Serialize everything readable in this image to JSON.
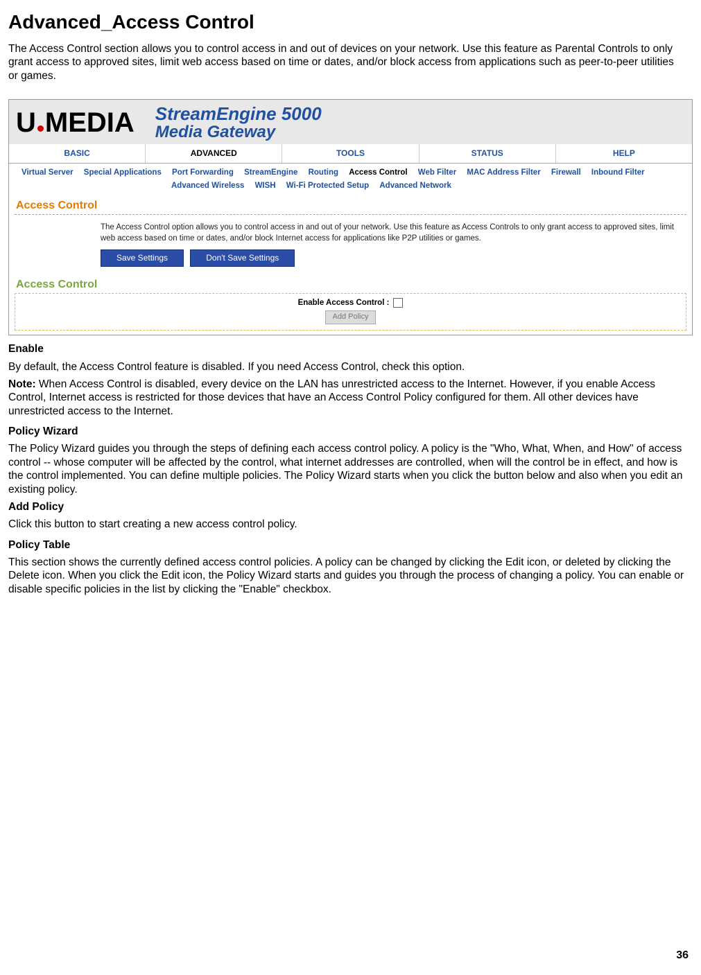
{
  "page": {
    "title": "Advanced_Access Control",
    "intro": "The Access Control section allows you to control access in and out of devices on your network. Use this feature as Parental Controls to only grant access to approved sites, limit web access based on time or dates, and/or block access from applications such as peer-to-peer utilities or games.",
    "number": "36"
  },
  "router": {
    "brand_u": "U",
    "brand_media": "MEDIA",
    "product_line1": "StreamEngine 5000",
    "product_line2": "Media Gateway",
    "tabs": [
      "BASIC",
      "ADVANCED",
      "TOOLS",
      "STATUS",
      "HELP"
    ],
    "subnav": [
      "Virtual Server",
      "Special Applications",
      "Port Forwarding",
      "StreamEngine",
      "Routing",
      "Access Control",
      "Web Filter",
      "MAC Address Filter",
      "Firewall",
      "Inbound Filter",
      "Advanced Wireless",
      "WISH",
      "Wi-Fi Protected Setup",
      "Advanced Network"
    ],
    "section1_title": "Access Control",
    "section1_blurb": "The Access Control option allows you to control access in and out of your network. Use this feature as Access Controls to only grant access to approved sites, limit web access based on time or dates, and/or block Internet access for applications like P2P utilities or games.",
    "save_btn": "Save Settings",
    "dont_save_btn": "Don't Save Settings",
    "section2_title": "Access Control",
    "enable_label": "Enable Access Control :",
    "add_policy_btn": "Add Policy"
  },
  "doc": {
    "enable_term": "Enable",
    "enable_para": "By default, the Access Control feature is disabled. If you need Access Control, check this option.",
    "note_label": "Note:",
    "note_text": " When Access Control is disabled, every device on the LAN has unrestricted access to the Internet. However, if you enable Access Control, Internet access is restricted for those devices that have an Access Control Policy configured for them. All other devices have unrestricted access to the Internet.",
    "wizard_term": "Policy Wizard",
    "wizard_para": "The Policy Wizard guides you through the steps of defining each access control policy. A policy is the \"Who, What, When, and How\" of access control -- whose computer will be affected by the control, what internet addresses are controlled, when will the control be in effect, and how is the control implemented. You can define multiple policies. The Policy Wizard starts when you click the button below and also when you edit an existing policy.",
    "add_policy_term": "Add Policy",
    "add_policy_para": "Click this button to start creating a new access control policy.",
    "table_term": "Policy Table",
    "table_para": "This section shows the currently defined access control policies. A policy can be changed by clicking the Edit icon, or deleted by clicking the Delete icon. When you click the Edit icon, the Policy Wizard starts and guides you through the process of changing a policy. You can enable or disable specific policies in the list by clicking the \"Enable\" checkbox."
  }
}
